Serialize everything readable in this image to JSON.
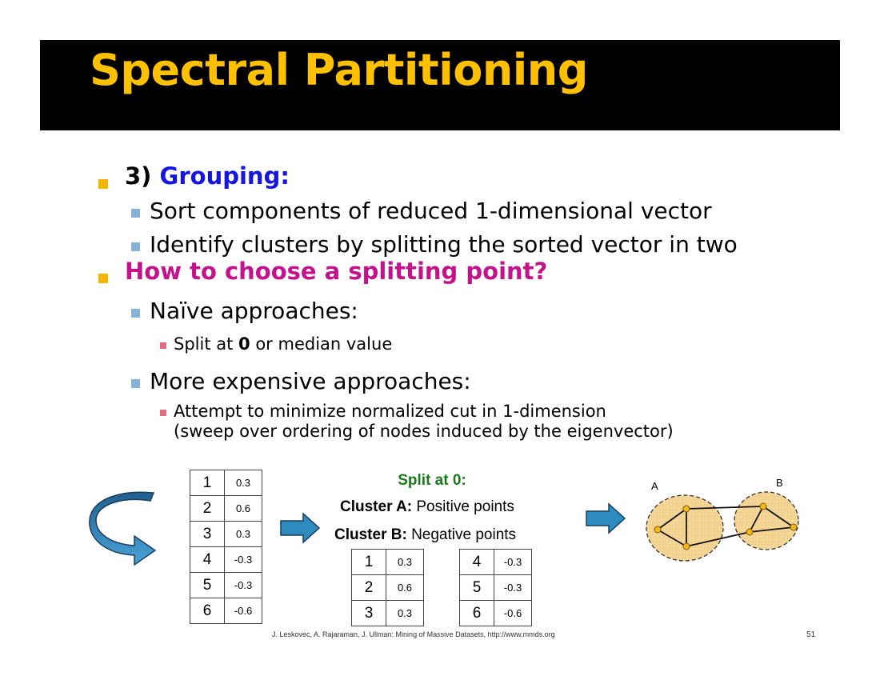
{
  "slide": {
    "title": "Spectral Partitioning",
    "bullets": {
      "grouping_num": "3)",
      "grouping_label": "Grouping:",
      "sort": "Sort components of reduced 1-dimensional vector",
      "identify": "Identify clusters by splitting the sorted vector in two",
      "how": "How to choose a splitting point?",
      "naive": "Naïve approaches:",
      "split_a": "Split at ",
      "split_zero": "0",
      "split_b": " or median value",
      "expensive": "More expensive approaches:",
      "attempt_1": "Attempt to minimize normalized cut in 1-dimension",
      "attempt_2": "(sweep over ordering of nodes induced by the eigenvector)"
    },
    "split": {
      "title": "Split at 0:",
      "cluster_a_label": "Cluster A:",
      "cluster_a_text": " Positive points",
      "cluster_b_label": "Cluster B:",
      "cluster_b_text": " Negative points"
    },
    "graph_labels": {
      "a": "A",
      "b": "B"
    },
    "footer": "J. Leskovec, A. Rajaraman, J. Ullman: Mining of Massive Datasets, http://www.mmds.org",
    "page_number": "51"
  },
  "tables": {
    "sorted_vector": [
      {
        "idx": "1",
        "val": "0.3"
      },
      {
        "idx": "2",
        "val": "0.6"
      },
      {
        "idx": "3",
        "val": "0.3"
      },
      {
        "idx": "4",
        "val": "-0.3"
      },
      {
        "idx": "5",
        "val": "-0.3"
      },
      {
        "idx": "6",
        "val": "-0.6"
      }
    ],
    "cluster_a": [
      {
        "idx": "1",
        "val": "0.3"
      },
      {
        "idx": "2",
        "val": "0.6"
      },
      {
        "idx": "3",
        "val": "0.3"
      }
    ],
    "cluster_b": [
      {
        "idx": "4",
        "val": "-0.3"
      },
      {
        "idx": "5",
        "val": "-0.3"
      },
      {
        "idx": "6",
        "val": "-0.6"
      }
    ]
  },
  "colors": {
    "title": "#ffc000",
    "grouping": "#1515e0",
    "question": "#c4128c",
    "split_title": "#1a7a1a",
    "arrow": "#2e8bc0",
    "cluster_fill": "#f6d79a"
  }
}
